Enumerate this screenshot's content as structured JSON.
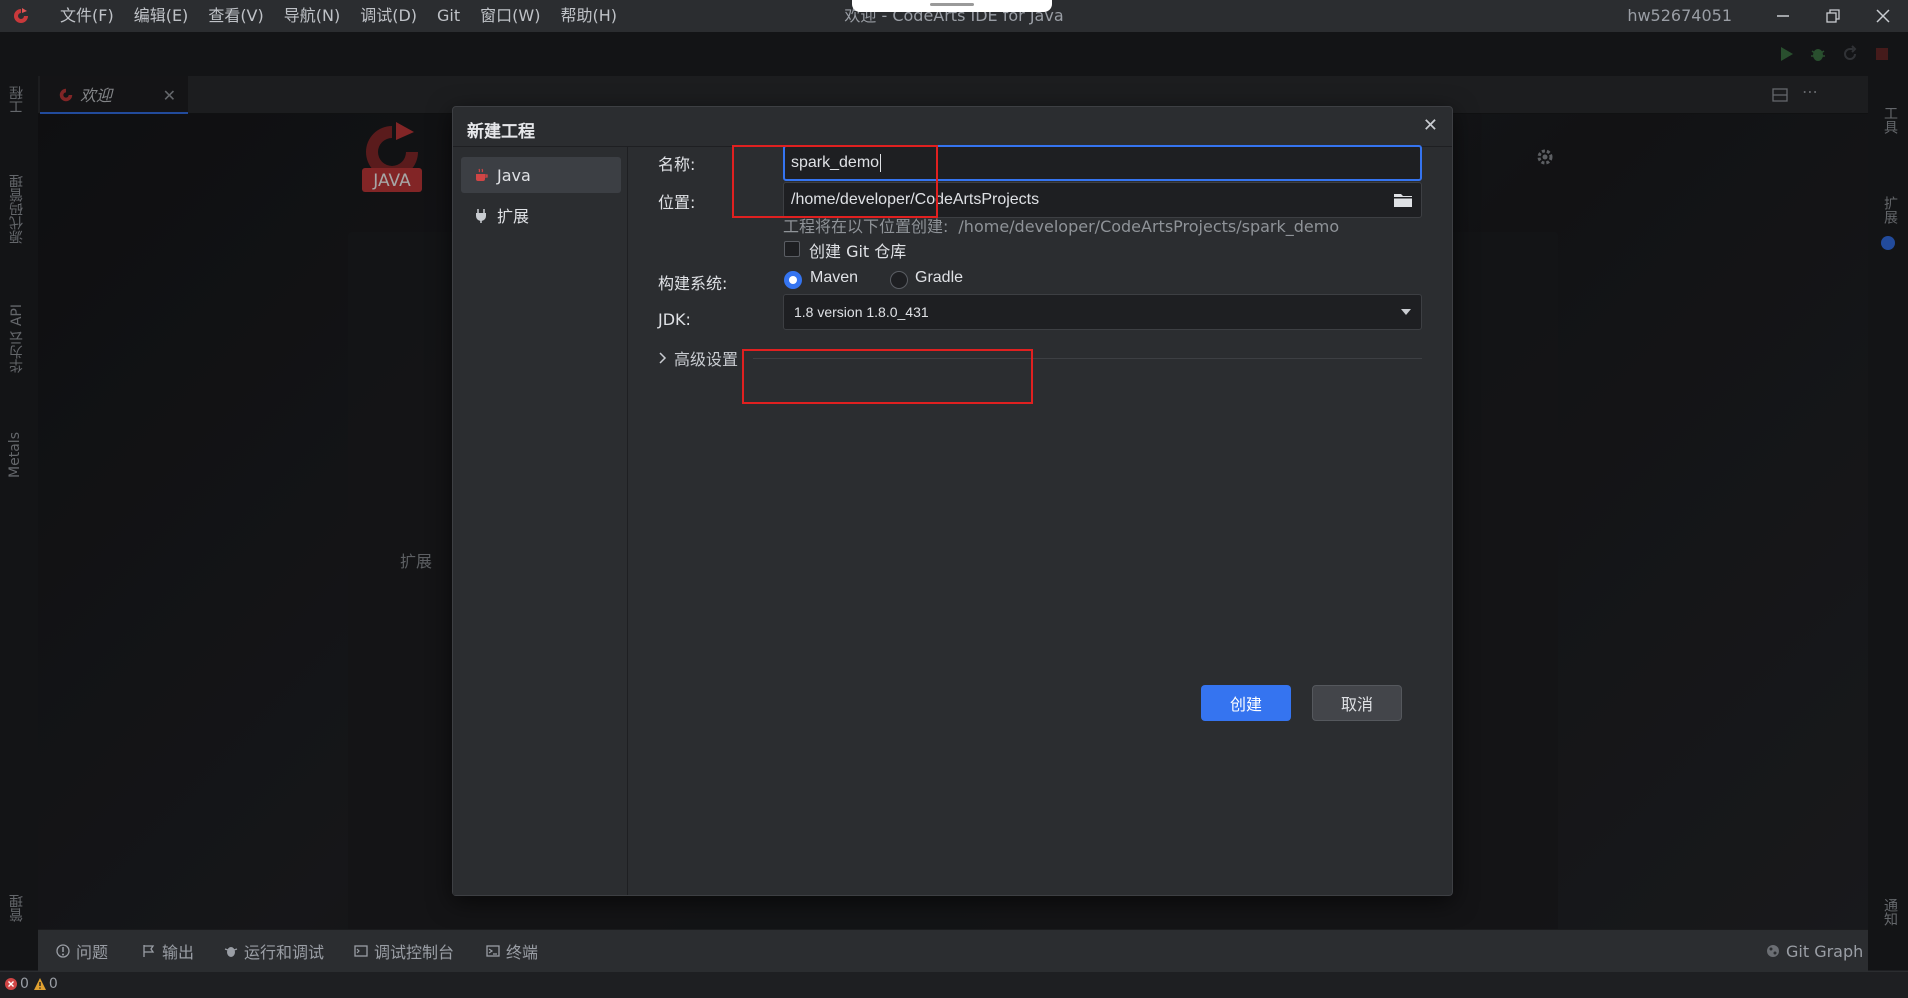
{
  "window": {
    "title": "欢迎 - CodeArts IDE for Java",
    "user": "hw52674051"
  },
  "menu": [
    "文件(F)",
    "编辑(E)",
    "查看(V)",
    "导航(N)",
    "调试(D)",
    "Git",
    "窗口(W)",
    "帮助(H)"
  ],
  "left_strip": [
    "工程",
    "源代码管理",
    "华为云 API",
    "Metals",
    "管理"
  ],
  "right_strip": [
    "工具",
    "扩展",
    "通知"
  ],
  "editor_tab": {
    "label": "欢迎"
  },
  "welcome": {
    "logo_text": "JAVA",
    "section_extensions": "扩展"
  },
  "dialog": {
    "title": "新建工程",
    "sidebar": [
      {
        "label": "Java",
        "icon": "coffee-icon",
        "selected": true
      },
      {
        "label": "扩展",
        "icon": "plug-icon",
        "selected": false
      }
    ],
    "name_label": "名称:",
    "name_value": "spark_demo",
    "location_label": "位置:",
    "location_value": "/home/developer/CodeArtsProjects",
    "hint_prefix": "工程将在以下位置创建:",
    "hint_path": "/home/developer/CodeArtsProjects/spark_demo",
    "git_checkbox_label": "创建 Git 仓库",
    "git_checked": false,
    "build_label": "构建系统:",
    "build_options": [
      {
        "label": "Maven",
        "selected": true
      },
      {
        "label": "Gradle",
        "selected": false
      }
    ],
    "jdk_label": "JDK:",
    "jdk_value": "1.8 version 1.8.0_431",
    "advanced_label": "高级设置",
    "create_button": "创建",
    "cancel_button": "取消"
  },
  "bottom_panel": [
    "问题",
    "输出",
    "运行和调试",
    "调试控制台",
    "终端"
  ],
  "bottom_right": "Git Graph",
  "status": {
    "errors": "0",
    "warnings": "0"
  },
  "colors": {
    "accent": "#3574f0",
    "annotation": "#e02020",
    "logo": "#c8393b"
  }
}
